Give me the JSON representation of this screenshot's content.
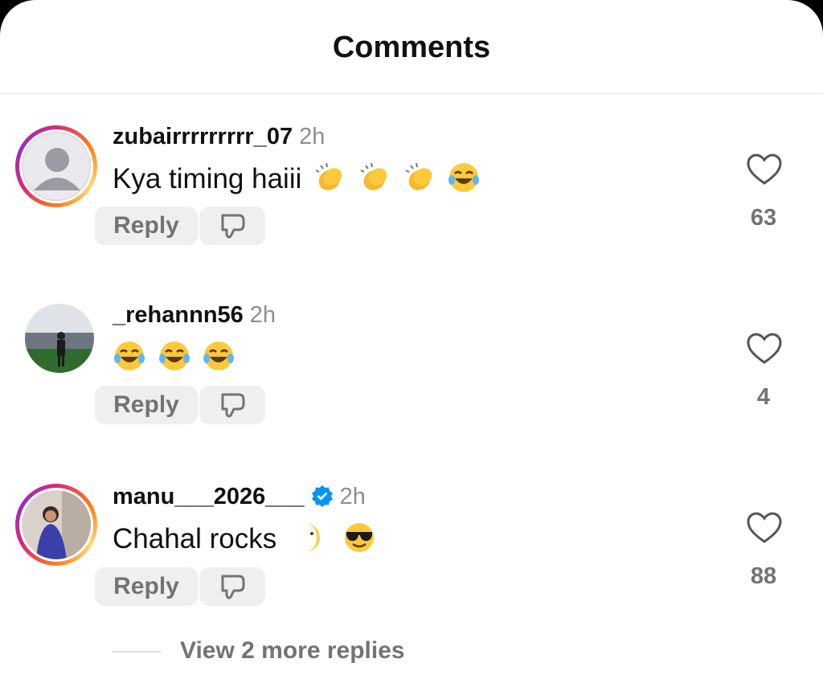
{
  "header": {
    "title": "Comments"
  },
  "comments": [
    {
      "username": "zubairrrrrrrrr_07",
      "time": "2h",
      "text": "Kya timing haiii",
      "emojis": [
        "clapping-hands",
        "clapping-hands",
        "clapping-hands",
        "tears-of-joy"
      ],
      "reply_label": "Reply",
      "likes": "63",
      "has_story_ring": true,
      "verified": false,
      "avatar": "default-person"
    },
    {
      "username": "_rehannn56",
      "time": "2h",
      "text": "",
      "emojis": [
        "tears-of-joy",
        "tears-of-joy",
        "tears-of-joy"
      ],
      "reply_label": "Reply",
      "likes": "4",
      "has_story_ring": false,
      "verified": false,
      "avatar": "stadium-photo"
    },
    {
      "username": "manu___2026___",
      "time": "2h",
      "text": "Chahal rocks ",
      "emojis": [
        "moon-face",
        "sunglasses-face"
      ],
      "reply_label": "Reply",
      "likes": "88",
      "has_story_ring": true,
      "verified": true,
      "avatar": "person-photo"
    }
  ],
  "more_replies": "View 2 more replies",
  "colors": {
    "verified": "#0095f6",
    "muted": "#737373",
    "ring_start": "#d62976",
    "ring_end": "#feda75"
  }
}
